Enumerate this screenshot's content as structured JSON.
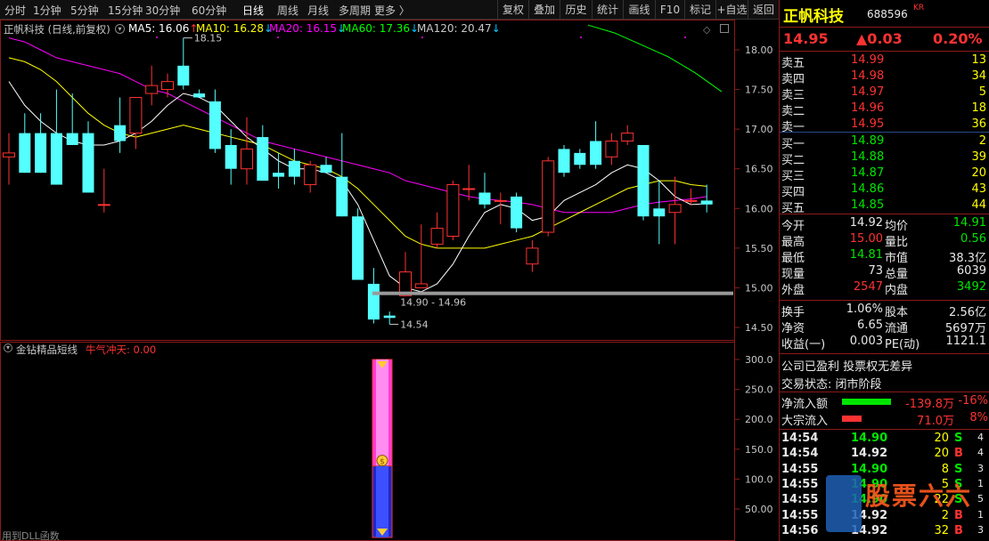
{
  "toolbar": {
    "periods": [
      "分时",
      "1分钟",
      "5分钟",
      "15分钟",
      "30分钟",
      "60分钟",
      "日线",
      "周线",
      "月线",
      "多周期",
      "更多 〉"
    ],
    "active_period": "日线",
    "buttons": [
      "复权",
      "叠加",
      "历史",
      "统计",
      "画线",
      "F10",
      "标记",
      "+自选",
      "返回"
    ]
  },
  "main_chart": {
    "title": "正帆科技 (日线,前复权)",
    "ma": [
      {
        "label": "MA5: 16.06",
        "arrow": "↑",
        "color": "#ffffff"
      },
      {
        "label": "MA10: 16.28",
        "arrow": "↓",
        "color": "#ffff00"
      },
      {
        "label": "MA20: 16.15",
        "arrow": "↓",
        "color": "#ff00ff"
      },
      {
        "label": "MA60: 17.36",
        "arrow": "↓",
        "color": "#00ff00"
      },
      {
        "label": "MA120: 20.47",
        "arrow": "↓",
        "color": "#c8c8c8"
      }
    ],
    "high_label": "18.15",
    "low_label": "14.54",
    "range_label": "14.90 - 14.96",
    "y_ticks": [
      "18.00",
      "17.50",
      "17.00",
      "16.50",
      "16.00",
      "15.50",
      "15.00",
      "14.50"
    ]
  },
  "sub_chart": {
    "title": "金钻精品短线",
    "indicator": "牛气冲天: 0.00",
    "y_ticks": [
      "300.0",
      "250.0",
      "200.0",
      "150.0",
      "100.0",
      "50.00"
    ],
    "footer": "用到DLL函数"
  },
  "chart_data": {
    "type": "candlestick",
    "ylim": [
      14.4,
      18.2
    ],
    "candles": [
      {
        "o": 16.65,
        "h": 16.95,
        "l": 16.3,
        "c": 16.7
      },
      {
        "o": 16.95,
        "h": 17.2,
        "l": 16.45,
        "c": 16.45
      },
      {
        "o": 16.95,
        "h": 17.2,
        "l": 16.45,
        "c": 16.45
      },
      {
        "o": 16.95,
        "h": 17.5,
        "l": 16.3,
        "c": 16.3
      },
      {
        "o": 16.95,
        "h": 17.45,
        "l": 16.8,
        "c": 16.8
      },
      {
        "o": 16.95,
        "h": 17.1,
        "l": 16.2,
        "c": 16.2
      },
      {
        "o": 16.05,
        "h": 16.5,
        "l": 15.95,
        "c": 16.05
      },
      {
        "o": 17.05,
        "h": 17.4,
        "l": 16.7,
        "c": 16.85
      },
      {
        "o": 16.95,
        "h": 17.4,
        "l": 16.75,
        "c": 17.4
      },
      {
        "o": 17.45,
        "h": 17.8,
        "l": 17.3,
        "c": 17.55
      },
      {
        "o": 17.5,
        "h": 17.7,
        "l": 17.4,
        "c": 17.6
      },
      {
        "o": 17.8,
        "h": 18.15,
        "l": 17.5,
        "c": 17.55
      },
      {
        "o": 17.45,
        "h": 17.5,
        "l": 17.4,
        "c": 17.4
      },
      {
        "o": 17.35,
        "h": 17.5,
        "l": 16.7,
        "c": 16.75
      },
      {
        "o": 16.8,
        "h": 17.0,
        "l": 16.3,
        "c": 16.5
      },
      {
        "o": 16.5,
        "h": 17.15,
        "l": 16.3,
        "c": 16.75
      },
      {
        "o": 16.9,
        "h": 17.05,
        "l": 16.35,
        "c": 16.35
      },
      {
        "o": 16.45,
        "h": 16.7,
        "l": 16.25,
        "c": 16.4
      },
      {
        "o": 16.6,
        "h": 16.75,
        "l": 16.3,
        "c": 16.4
      },
      {
        "o": 16.3,
        "h": 16.6,
        "l": 16.2,
        "c": 16.55
      },
      {
        "o": 16.55,
        "h": 16.65,
        "l": 16.45,
        "c": 16.45
      },
      {
        "o": 16.4,
        "h": 16.95,
        "l": 15.9,
        "c": 15.9
      },
      {
        "o": 15.9,
        "h": 16.0,
        "l": 15.1,
        "c": 15.1
      },
      {
        "o": 15.05,
        "h": 15.25,
        "l": 14.55,
        "c": 14.6
      },
      {
        "o": 14.65,
        "h": 14.7,
        "l": 14.54,
        "c": 14.62
      },
      {
        "o": 14.9,
        "h": 15.45,
        "l": 14.9,
        "c": 15.2
      },
      {
        "o": 15.0,
        "h": 15.8,
        "l": 15.0,
        "c": 15.05
      },
      {
        "o": 15.55,
        "h": 15.95,
        "l": 15.5,
        "c": 15.75
      },
      {
        "o": 15.65,
        "h": 16.35,
        "l": 15.6,
        "c": 16.3
      },
      {
        "o": 16.25,
        "h": 16.55,
        "l": 16.1,
        "c": 16.25
      },
      {
        "o": 16.2,
        "h": 16.45,
        "l": 16.0,
        "c": 16.05
      },
      {
        "o": 16.1,
        "h": 16.2,
        "l": 15.8,
        "c": 16.1
      },
      {
        "o": 16.15,
        "h": 16.2,
        "l": 15.7,
        "c": 15.75
      },
      {
        "o": 15.3,
        "h": 15.6,
        "l": 15.2,
        "c": 15.5
      },
      {
        "o": 15.7,
        "h": 16.65,
        "l": 15.65,
        "c": 16.6
      },
      {
        "o": 16.75,
        "h": 16.8,
        "l": 16.4,
        "c": 16.45
      },
      {
        "o": 16.7,
        "h": 16.75,
        "l": 16.5,
        "c": 16.55
      },
      {
        "o": 16.85,
        "h": 17.1,
        "l": 16.5,
        "c": 16.55
      },
      {
        "o": 16.65,
        "h": 16.95,
        "l": 16.55,
        "c": 16.85
      },
      {
        "o": 16.85,
        "h": 17.05,
        "l": 16.8,
        "c": 16.95
      },
      {
        "o": 16.8,
        "h": 16.8,
        "l": 15.85,
        "c": 15.9
      },
      {
        "o": 16.0,
        "h": 16.35,
        "l": 15.55,
        "c": 15.9
      },
      {
        "o": 15.95,
        "h": 16.4,
        "l": 15.55,
        "c": 16.05
      },
      {
        "o": 16.1,
        "h": 16.25,
        "l": 16.05,
        "c": 16.1
      },
      {
        "o": 16.1,
        "h": 16.3,
        "l": 15.95,
        "c": 16.05
      }
    ],
    "ma5": [
      17.6,
      17.3,
      17.1,
      16.95,
      16.85,
      16.8,
      16.8,
      16.85,
      16.95,
      17.1,
      17.3,
      17.45,
      17.4,
      17.3,
      17.1,
      16.9,
      16.75,
      16.6,
      16.5,
      16.5,
      16.45,
      16.35,
      16.05,
      15.6,
      15.15,
      15.0,
      14.95,
      15.05,
      15.3,
      15.65,
      15.95,
      16.05,
      16.0,
      15.85,
      15.9,
      16.1,
      16.2,
      16.3,
      16.45,
      16.55,
      16.5,
      16.35,
      16.15,
      16.05,
      16.06
    ],
    "ma10": [
      17.9,
      17.85,
      17.75,
      17.6,
      17.4,
      17.2,
      17.05,
      16.95,
      16.9,
      16.95,
      17.0,
      17.05,
      17.0,
      16.95,
      16.9,
      16.85,
      16.8,
      16.7,
      16.6,
      16.55,
      16.5,
      16.4,
      16.25,
      16.05,
      15.85,
      15.65,
      15.55,
      15.5,
      15.5,
      15.5,
      15.5,
      15.55,
      15.6,
      15.65,
      15.75,
      15.85,
      15.95,
      16.05,
      16.15,
      16.25,
      16.3,
      16.35,
      16.35,
      16.3,
      16.28
    ],
    "ma20": [
      18.15,
      18.1,
      18.0,
      17.9,
      17.85,
      17.8,
      17.75,
      17.7,
      17.6,
      17.5,
      17.45,
      17.35,
      17.25,
      17.15,
      17.05,
      16.95,
      16.85,
      16.8,
      16.75,
      16.7,
      16.65,
      16.6,
      16.55,
      16.5,
      16.45,
      16.35,
      16.3,
      16.25,
      16.2,
      16.15,
      16.12,
      16.1,
      16.08,
      16.05,
      16.0,
      15.95,
      15.95,
      15.95,
      15.95,
      16.0,
      16.05,
      16.08,
      16.1,
      16.12,
      16.15
    ],
    "ma60": [
      18.2,
      18.1,
      17.95,
      17.8,
      17.6,
      17.36
    ],
    "volume_bar": {
      "top": 300,
      "mid": 122,
      "bottom": 0
    }
  },
  "quote": {
    "name": "正帆科技",
    "code": "688596",
    "tag": "KR",
    "price": "14.95",
    "change": "▲0.03",
    "pct": "0.20%",
    "asks": [
      {
        "label": "卖五",
        "price": "14.99",
        "vol": "13"
      },
      {
        "label": "卖四",
        "price": "14.98",
        "vol": "34"
      },
      {
        "label": "卖三",
        "price": "14.97",
        "vol": "5"
      },
      {
        "label": "卖二",
        "price": "14.96",
        "vol": "18"
      },
      {
        "label": "卖一",
        "price": "14.95",
        "vol": "36"
      }
    ],
    "bids": [
      {
        "label": "买一",
        "price": "14.89",
        "vol": "2"
      },
      {
        "label": "买二",
        "price": "14.88",
        "vol": "39"
      },
      {
        "label": "买三",
        "price": "14.87",
        "vol": "20"
      },
      {
        "label": "买四",
        "price": "14.86",
        "vol": "43"
      },
      {
        "label": "买五",
        "price": "14.85",
        "vol": "44"
      }
    ],
    "stats": [
      {
        "l1": "今开",
        "v1": "14.92",
        "c1": "white",
        "l2": "均价",
        "v2": "14.91",
        "c2": "green"
      },
      {
        "l1": "最高",
        "v1": "15.00",
        "c1": "red",
        "l2": "量比",
        "v2": "0.56",
        "c2": "green"
      },
      {
        "l1": "最低",
        "v1": "14.81",
        "c1": "green",
        "l2": "市值",
        "v2": "38.3亿",
        "c2": "white"
      },
      {
        "l1": "现量",
        "v1": "73",
        "c1": "white",
        "l2": "总量",
        "v2": "6039",
        "c2": "white"
      },
      {
        "l1": "外盘",
        "v1": "2547",
        "c1": "red",
        "l2": "内盘",
        "v2": "3492",
        "c2": "green"
      }
    ],
    "stats2": [
      {
        "l1": "换手",
        "v1": "1.06%",
        "l2": "股本",
        "v2": "2.56亿"
      },
      {
        "l1": "净资",
        "v1": "6.65",
        "l2": "流通",
        "v2": "5697万"
      },
      {
        "l1": "收益(一)",
        "v1": "0.003",
        "l2": "PE(动)",
        "v2": "1121.1"
      }
    ],
    "info1": "公司已盈利 投票权无差异",
    "info2": "交易状态: 闭市阶段",
    "flows": [
      {
        "label": "净流入额",
        "value": "-139.8万",
        "pct": "-16%",
        "color": "#00e600",
        "fill": 0.55
      },
      {
        "label": "大宗流入",
        "value": "71.0万",
        "pct": "8%",
        "color": "#ff3232",
        "fill": 0.22
      }
    ],
    "ticks": [
      {
        "time": "14:54",
        "price": "14.90",
        "pc": "green",
        "vol": "20",
        "side": "S",
        "sc": "green",
        "n": "4"
      },
      {
        "time": "14:54",
        "price": "14.92",
        "pc": "white",
        "vol": "20",
        "side": "B",
        "sc": "red",
        "n": "4"
      },
      {
        "time": "14:55",
        "price": "14.90",
        "pc": "green",
        "vol": "8",
        "side": "S",
        "sc": "green",
        "n": "3"
      },
      {
        "time": "14:55",
        "price": "14.90",
        "pc": "green",
        "vol": "5",
        "side": "S",
        "sc": "green",
        "n": "1"
      },
      {
        "time": "14:55",
        "price": "14.90",
        "pc": "green",
        "vol": "22",
        "side": "S",
        "sc": "green",
        "n": "5"
      },
      {
        "time": "14:55",
        "price": "14.92",
        "pc": "white",
        "vol": "2",
        "side": "B",
        "sc": "red",
        "n": "1"
      },
      {
        "time": "14:56",
        "price": "14.92",
        "pc": "white",
        "vol": "32",
        "side": "B",
        "sc": "red",
        "n": "3"
      }
    ],
    "watermark": "股票六六"
  }
}
